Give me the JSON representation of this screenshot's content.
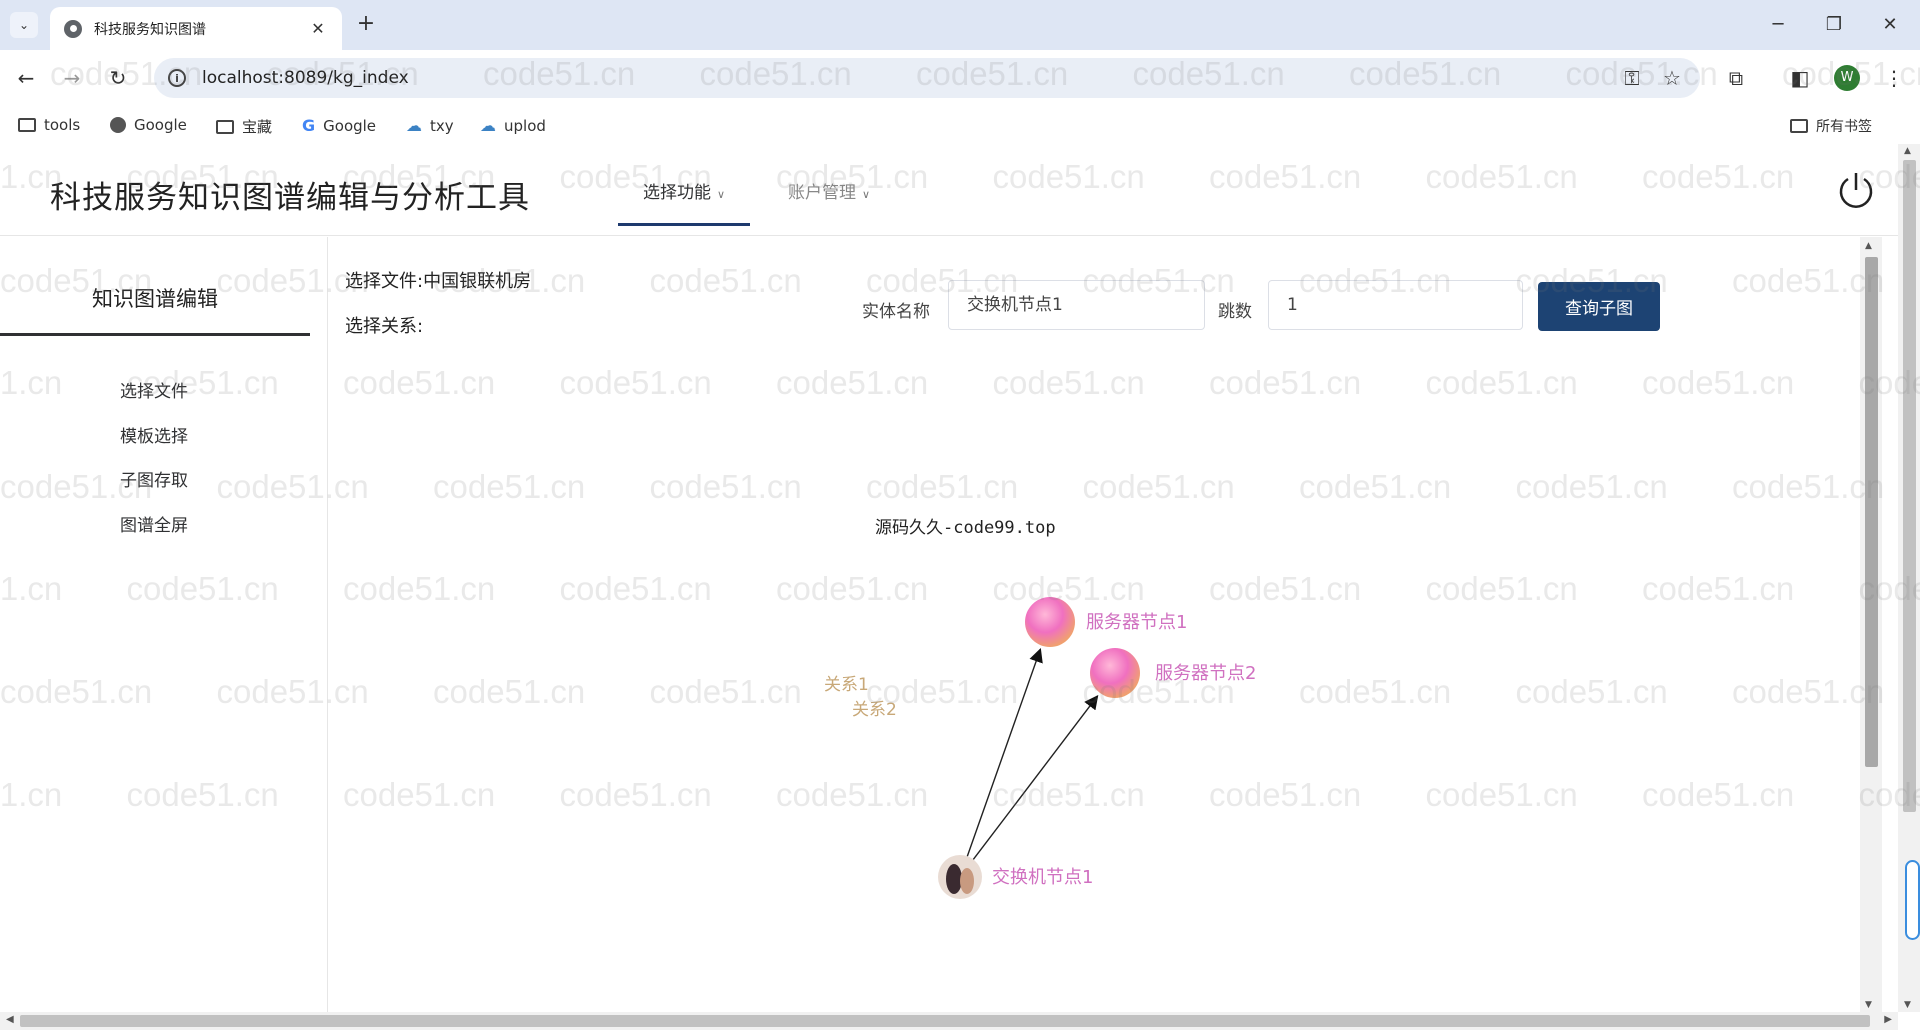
{
  "browser": {
    "tab_title": "科技服务知识图谱",
    "url": "localhost:8089/kg_index",
    "bookmarks": [
      {
        "label": "tools",
        "icon": "folder-icon"
      },
      {
        "label": "Google",
        "icon": "globe-icon"
      },
      {
        "label": "宝藏",
        "icon": "folder-icon"
      },
      {
        "label": "Google",
        "icon": "google-icon"
      },
      {
        "label": "txy",
        "icon": "cloud-icon"
      },
      {
        "label": "uplod",
        "icon": "cloud-icon"
      }
    ],
    "all_bookmarks": "所有书签",
    "profile_initial": "W"
  },
  "header": {
    "title": "科技服务知识图谱编辑与分析工具",
    "menu": [
      {
        "label": "选择功能",
        "active": true
      },
      {
        "label": "账户管理",
        "active": false
      }
    ]
  },
  "sidebar": {
    "title": "知识图谱编辑",
    "items": [
      {
        "label": "选择文件"
      },
      {
        "label": "模板选择"
      },
      {
        "label": "子图存取"
      },
      {
        "label": "图谱全屏"
      }
    ]
  },
  "main": {
    "file_label": "选择文件:中国银联机房",
    "relation_label": "选择关系:",
    "entity_label": "实体名称",
    "entity_value": "交换机节点1",
    "hops_label": "跳数",
    "hops_value": "1",
    "query_button": "查询子图",
    "source_text": "源码久久-code99.top"
  },
  "graph": {
    "nodes": [
      {
        "id": "n0",
        "label": "交换机节点1",
        "kind": "avatar"
      },
      {
        "id": "n1",
        "label": "服务器节点1",
        "kind": "bubble"
      },
      {
        "id": "n2",
        "label": "服务器节点2",
        "kind": "bubble"
      }
    ],
    "edges": [
      {
        "from": "n0",
        "to": "n1",
        "label": "关系1"
      },
      {
        "from": "n0",
        "to": "n2",
        "label": "关系2"
      }
    ],
    "node_label_color": "#d070c0",
    "edge_label_color": "#c8a878"
  },
  "watermark": "code51.cn"
}
